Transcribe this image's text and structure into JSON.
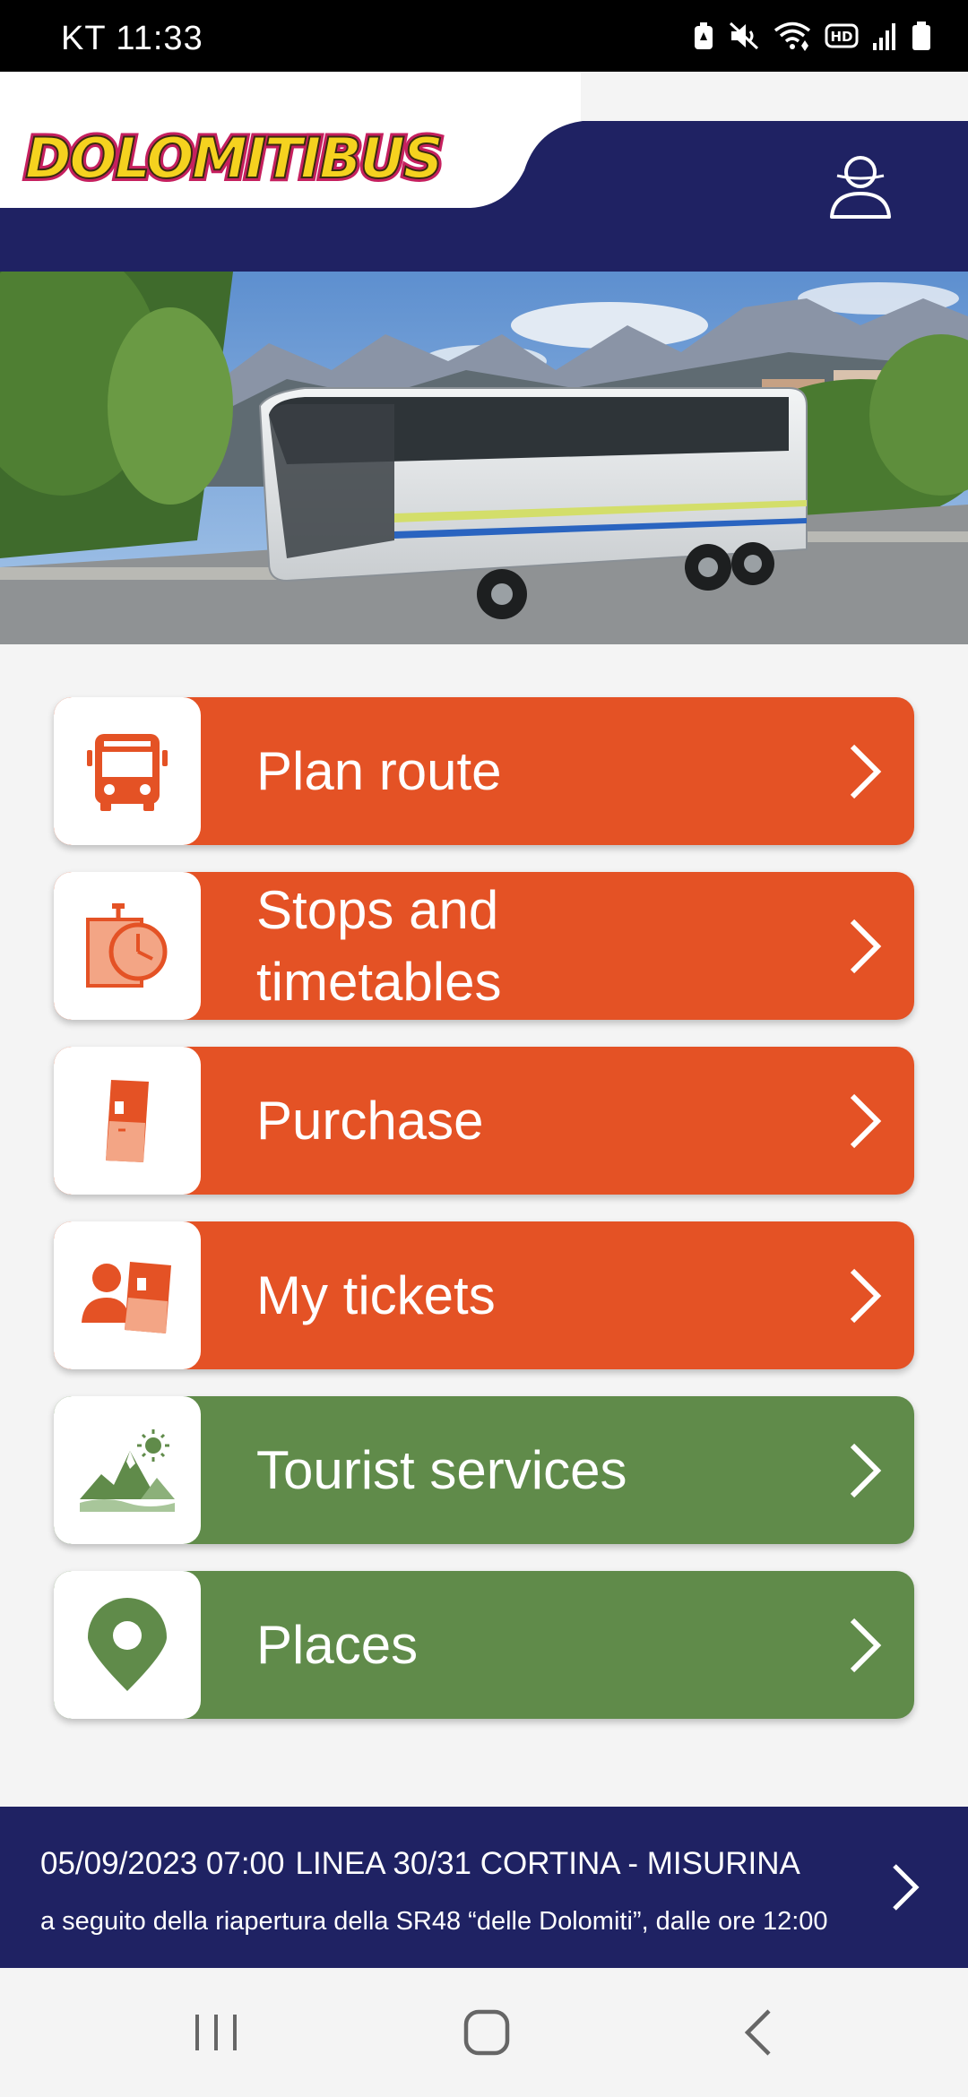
{
  "status_bar": {
    "time": "KT 11:33",
    "icons": [
      "battery-saver-icon",
      "mute-icon",
      "wifi-icon",
      "hd-icon",
      "signal-icon",
      "battery-icon"
    ]
  },
  "header": {
    "logo_text": "DolomitiBus",
    "brand_color": "#1f2263",
    "profile_icon": "user-icon"
  },
  "hero": {
    "image": "coach bus on mountain road in the Dolomites"
  },
  "menu": {
    "items": [
      {
        "label": "Plan route",
        "icon": "bus-icon",
        "color": "#e45225"
      },
      {
        "label": "Stops and timetables",
        "icon": "stopwatch-icon",
        "color": "#e45225"
      },
      {
        "label": "Purchase",
        "icon": "ticket-icon",
        "color": "#e45225"
      },
      {
        "label": "My tickets",
        "icon": "user-ticket-icon",
        "color": "#e45225"
      },
      {
        "label": "Tourist services",
        "icon": "mountain-icon",
        "color": "#608b4a"
      },
      {
        "label": "Places",
        "icon": "map-pin-icon",
        "color": "#608b4a"
      }
    ]
  },
  "news": {
    "datetime": "05/09/2023 07:00",
    "title": "LINEA 30/31 CORTINA - MISURINA",
    "text": "a seguito della riapertura della SR48 “delle Dolomiti”, dalle ore 12:00"
  },
  "navbar": {
    "buttons": [
      "recent-apps-icon",
      "home-icon",
      "back-icon"
    ]
  }
}
